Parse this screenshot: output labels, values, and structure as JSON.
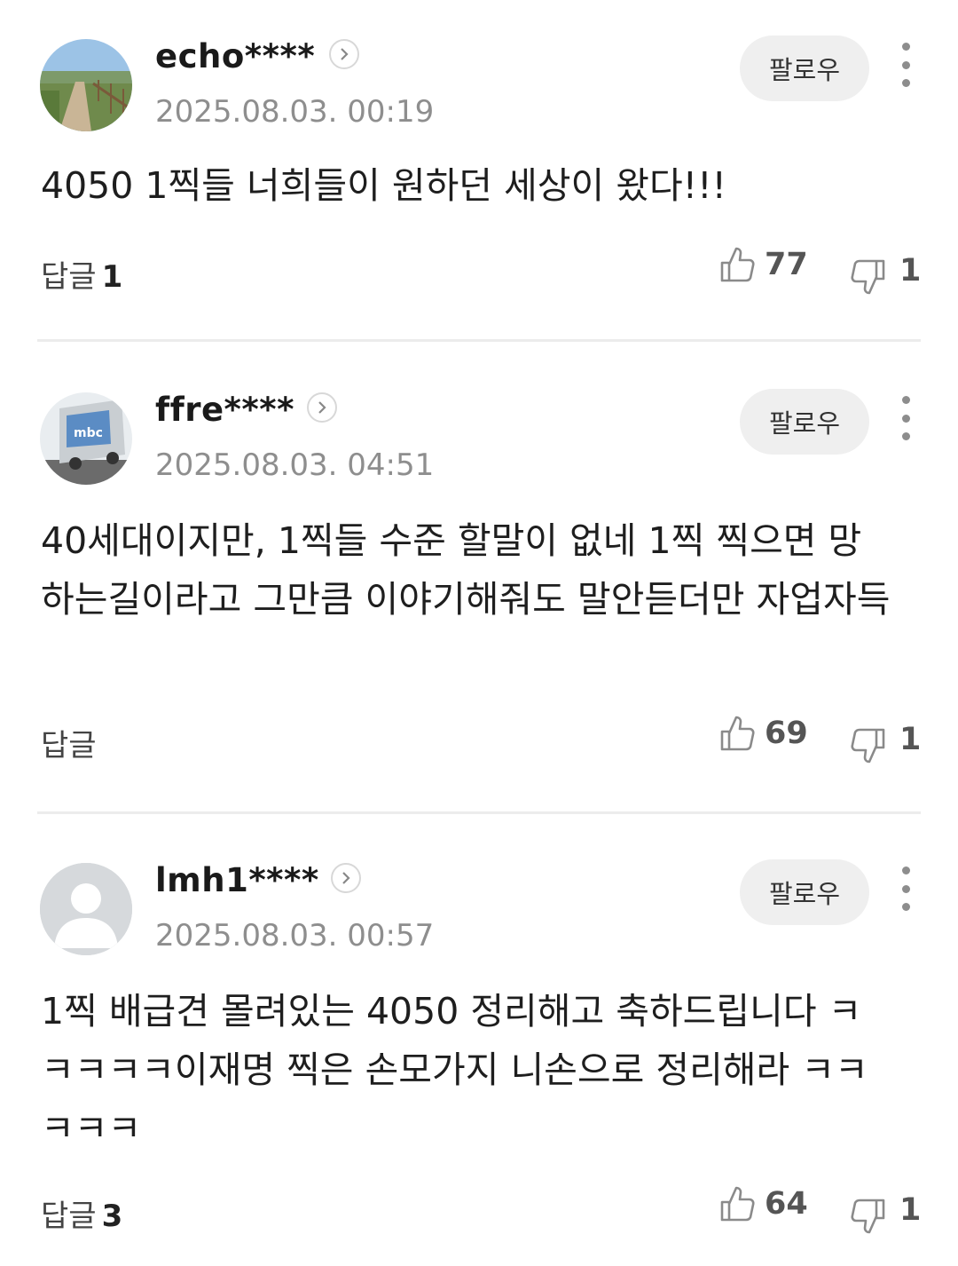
{
  "comments": [
    {
      "username": "echo****",
      "date": "2025.08.03. 00:19",
      "follow_label": "팔로우",
      "text": "4050 1찍들 너희들이 원하던 세상이 왔다!!!",
      "reply_label": "답글",
      "reply_count": "1",
      "likes": "77",
      "dislikes": "1",
      "avatar": "landscape-path-photo"
    },
    {
      "username": "ffre****",
      "date": "2025.08.03. 04:51",
      "follow_label": "팔로우",
      "text": "40세대이지만, 1찍들 수준 할말이 없네 1찍 찍으면 망하는길이라고 그만큼 이야기해줘도 말안듣더만 자업자득",
      "reply_label": "답글",
      "reply_count": "",
      "likes": "69",
      "dislikes": "1",
      "avatar": "bus-photo"
    },
    {
      "username": "lmh1****",
      "date": "2025.08.03. 00:57",
      "follow_label": "팔로우",
      "text": "1찍 배급견 몰려있는 4050 정리해고 축하드립니다 ㅋㅋㅋㅋㅋ이재명 찍은 손모가지 니손으로 정리해라 ㅋㅋㅋㅋㅋ",
      "reply_label": "답글",
      "reply_count": "3",
      "likes": "64",
      "dislikes": "1",
      "avatar": "default-person"
    }
  ]
}
